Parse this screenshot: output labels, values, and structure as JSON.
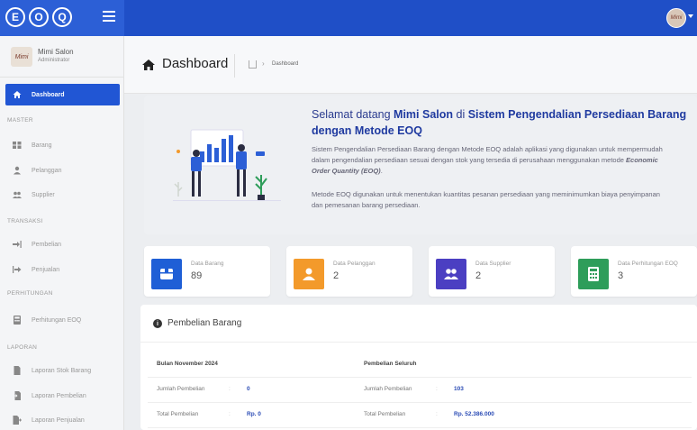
{
  "brand": {
    "letters": [
      "E",
      "O",
      "Q"
    ]
  },
  "user": {
    "name": "Mimi Salon",
    "role": "Administrator",
    "logo_text": "Mimi"
  },
  "sidebar": {
    "active": {
      "label": "Dashboard"
    },
    "sections": [
      {
        "label": "MASTER",
        "items": [
          {
            "label": "Barang"
          },
          {
            "label": "Pelanggan"
          },
          {
            "label": "Supplier"
          }
        ]
      },
      {
        "label": "TRANSAKSI",
        "items": [
          {
            "label": "Pembelian"
          },
          {
            "label": "Penjualan"
          }
        ]
      },
      {
        "label": "PERHITUNGAN",
        "items": [
          {
            "label": "Perhitungan EOQ"
          }
        ]
      },
      {
        "label": "LAPORAN",
        "items": [
          {
            "label": "Laporan Stok Barang"
          },
          {
            "label": "Laporan Pembelian"
          },
          {
            "label": "Laporan Penjualan"
          }
        ]
      }
    ]
  },
  "header": {
    "title": "Dashboard",
    "breadcrumb": "Dashboard"
  },
  "welcome": {
    "title_pre": "Selamat datang ",
    "title_name": "Mimi Salon",
    "title_mid": " di ",
    "title_system": "Sistem Pengendalian Persediaan Barang dengan Metode EOQ",
    "p1_pre": "Sistem Pengendalian Persediaan Barang dengan Metode EOQ adalah aplikasi yang digunakan untuk mempermudah dalam pengendalian persediaan sesuai dengan stok yang tersedia di perusahaan menggunakan metode ",
    "p1_em": "Economic Order Quantity (EOQ)",
    "p1_post": ".",
    "p2": "Metode EOQ digunakan untuk menentukan kuantitas pesanan persediaan yang meminimumkan biaya penyimpanan dan pemesanan barang persediaan."
  },
  "cards": [
    {
      "title": "Data Barang",
      "value": "89",
      "color": "#1f5fd6",
      "icon": "box-icon"
    },
    {
      "title": "Data Pelanggan",
      "value": "2",
      "color": "#f39a2b",
      "icon": "user-icon"
    },
    {
      "title": "Data Supplier",
      "value": "2",
      "color": "#4b3fc2",
      "icon": "users-icon"
    },
    {
      "title": "Data Perhitungan EOQ",
      "value": "3",
      "color": "#2e9d5a",
      "icon": "calculator-icon"
    }
  ],
  "pembelian": {
    "title": "Pembelian Barang",
    "col1_head": "Bulan November 2024",
    "col2_head": "Pembelian Seluruh",
    "rows": [
      {
        "label1": "Jumlah Pembelian",
        "value1": "0",
        "label2": "Jumlah Pembelian",
        "value2": "103"
      },
      {
        "label1": "Total Pembelian",
        "value1": "Rp. 0",
        "label2": "Total Pembelian",
        "value2": "Rp. 52.386.000"
      }
    ],
    "colon": ":"
  },
  "colors": {
    "topbar": "#1f4fc7",
    "accent": "#2156d4",
    "title_blue": "#1f3aa0"
  }
}
